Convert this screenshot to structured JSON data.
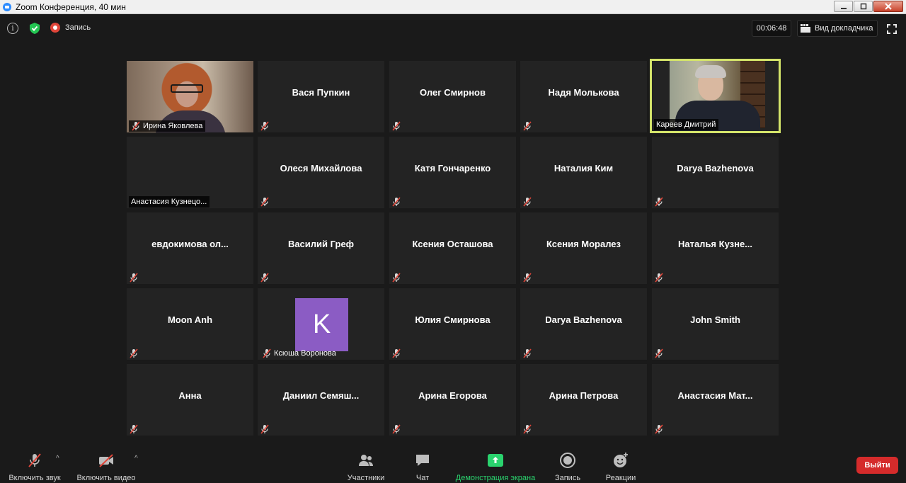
{
  "window": {
    "title": "Zoom Конференция, 40 мин"
  },
  "topbar": {
    "info_glyph": "i",
    "recording_label": "Запись",
    "timer": "00:06:48",
    "speaker_view_label": "Вид докладчика"
  },
  "participants": [
    {
      "name": "Ирина Яковлева",
      "video": true,
      "muted": true
    },
    {
      "name": "Вася Пупкин",
      "video": false,
      "muted": true
    },
    {
      "name": "Олег Смирнов",
      "video": false,
      "muted": true
    },
    {
      "name": "Надя Молькова",
      "video": false,
      "muted": true
    },
    {
      "name": "Кареев Дмитрий",
      "video": true,
      "muted": false,
      "active_speaker": true
    },
    {
      "name": "Анастасия Кузнецо...",
      "video": false,
      "muted": false,
      "label_only": true
    },
    {
      "name": "Олеся Михайлова",
      "video": false,
      "muted": true
    },
    {
      "name": "Катя Гончаренко",
      "video": false,
      "muted": true
    },
    {
      "name": "Наталия Ким",
      "video": false,
      "muted": true
    },
    {
      "name": "Darya Bazhenova",
      "video": false,
      "muted": true
    },
    {
      "name": "евдокимова  ол...",
      "video": false,
      "muted": true
    },
    {
      "name": "Василий Греф",
      "video": false,
      "muted": true
    },
    {
      "name": "Ксения Осташова",
      "video": false,
      "muted": true
    },
    {
      "name": "Ксения Моралез",
      "video": false,
      "muted": true
    },
    {
      "name": "Наталья  Кузне...",
      "video": false,
      "muted": true
    },
    {
      "name": "Moon Anh",
      "video": false,
      "muted": true
    },
    {
      "name": "Ксюша Воронова",
      "video": false,
      "muted": true,
      "avatar_letter": "K"
    },
    {
      "name": "Юлия Смирнова",
      "video": false,
      "muted": true
    },
    {
      "name": "Darya Bazhenova",
      "video": false,
      "muted": true
    },
    {
      "name": "John Smith",
      "video": false,
      "muted": true
    },
    {
      "name": "Анна",
      "video": false,
      "muted": true
    },
    {
      "name": "Даниил  Семяш...",
      "video": false,
      "muted": true
    },
    {
      "name": "Арина Егорова",
      "video": false,
      "muted": true
    },
    {
      "name": "Арина Петрова",
      "video": false,
      "muted": true
    },
    {
      "name": "Анастасия  Мат...",
      "video": false,
      "muted": true
    }
  ],
  "toolbar": {
    "unmute_label": "Включить звук",
    "start_video_label": "Включить видео",
    "participants_label": "Участники",
    "chat_label": "Чат",
    "share_screen_label": "Демонстрация экрана",
    "record_label": "Запись",
    "reactions_label": "Реакции",
    "leave_label": "Выйти"
  },
  "colors": {
    "active_speaker_border": "#d4e46a",
    "share_green": "#2ad36e",
    "leave_red": "#d52b2b",
    "avatar_purple": "#8b5cc4",
    "mic_off_red": "#e0463a"
  },
  "icons": {
    "mic_off": "mic-off-icon",
    "video_off": "video-off-icon",
    "participants": "people-icon",
    "chat": "chat-bubble-icon",
    "share": "share-screen-icon",
    "record": "record-icon",
    "reactions": "smiley-plus-icon",
    "shield": "shield-check-icon",
    "fullscreen": "fullscreen-icon"
  }
}
